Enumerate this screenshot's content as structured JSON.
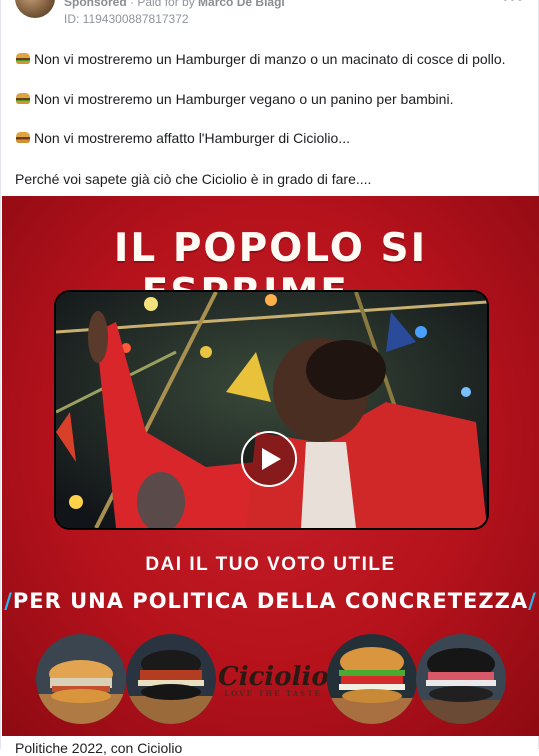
{
  "post": {
    "sponsored_label": "Sponsored",
    "paid_for_text": " · Paid for by ",
    "payer": "Marco De Biagi",
    "ad_id": "ID: 1194300887817372",
    "more_label": "•••",
    "lines": [
      "Non vi mostreremo un Hamburger di manzo o un macinato di cosce di pollo.",
      "Non vi mostreremo un Hamburger vegano o un panino per bambini.",
      "Non vi mostreremo affatto l'Hamburger di Ciciolio...",
      "Perché voi sapete già ciò che Ciciolio è in grado di fare...."
    ],
    "caption": "Politiche 2022, con Ciciolio"
  },
  "creative": {
    "headline": "IL POPOLO SI ESPRIME...",
    "subline": "DAI IL TUO VOTO UTILE",
    "slogan": "PER UNA POLITICA DELLA CONCRETEZZA",
    "slogan_bar_left": "/",
    "slogan_bar_right": "/",
    "logo_text": "Ciciolio",
    "logo_tagline": "LOVE THE TASTE",
    "colors": {
      "background": "#b5121c",
      "accent": "#29b6f6",
      "text": "#ffffff"
    }
  },
  "icons": {
    "post_line_icon": "hamburger-emoji",
    "video_control": "play-icon"
  }
}
